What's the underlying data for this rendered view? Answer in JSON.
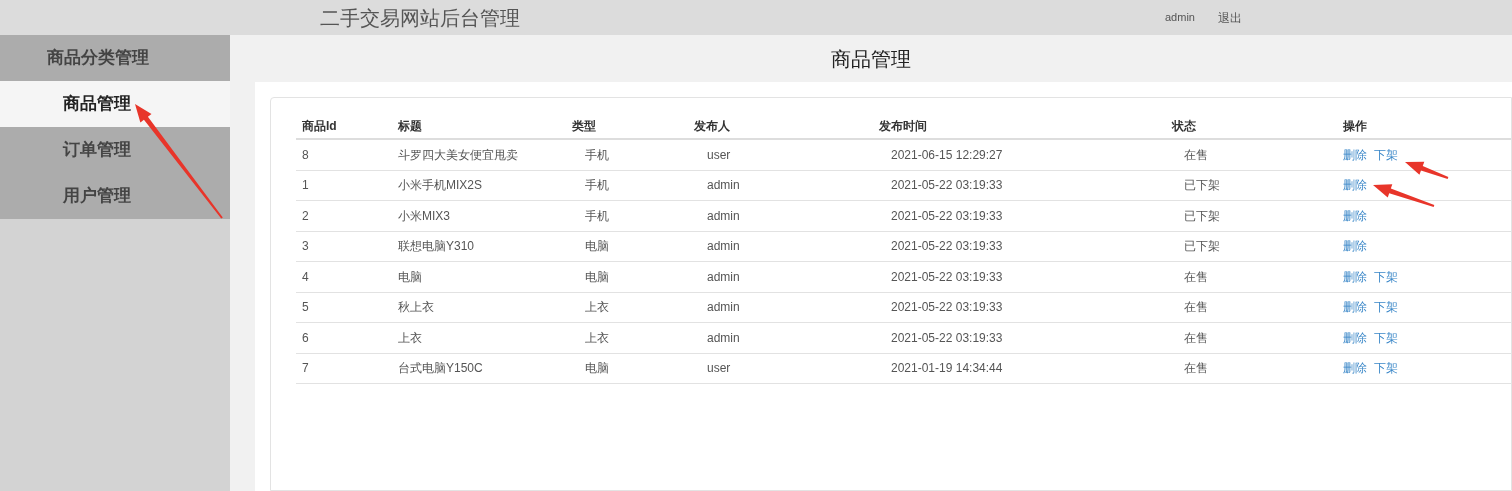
{
  "header": {
    "title": "二手交易网站后台管理",
    "user": "admin",
    "logout": "退出"
  },
  "sidebar": {
    "items": [
      {
        "label": "商品分类管理",
        "kind": "header",
        "selected": false
      },
      {
        "label": "商品管理",
        "kind": "item",
        "selected": true
      },
      {
        "label": "订单管理",
        "kind": "item",
        "selected": false
      },
      {
        "label": "用户管理",
        "kind": "item",
        "selected": false
      }
    ]
  },
  "page_title": "商品管理",
  "table": {
    "columns": [
      "商品Id",
      "标题",
      "类型",
      "发布人",
      "发布时间",
      "状态",
      "操作"
    ],
    "rows": [
      {
        "cells": [
          "8",
          "斗罗四大美女便宜甩卖",
          "手机",
          "user",
          "2021-06-15 12:29:27",
          "在售"
        ],
        "actions": [
          "删除",
          "下架"
        ]
      },
      {
        "cells": [
          "1",
          "小米手机MIX2S",
          "手机",
          "admin",
          "2021-05-22 03:19:33",
          "已下架"
        ],
        "actions": [
          "删除"
        ]
      },
      {
        "cells": [
          "2",
          "小米MIX3",
          "手机",
          "admin",
          "2021-05-22 03:19:33",
          "已下架"
        ],
        "actions": [
          "删除"
        ]
      },
      {
        "cells": [
          "3",
          "联想电脑Y310",
          "电脑",
          "admin",
          "2021-05-22 03:19:33",
          "已下架"
        ],
        "actions": [
          "删除"
        ]
      },
      {
        "cells": [
          "4",
          "电脑",
          "电脑",
          "admin",
          "2021-05-22 03:19:33",
          "在售"
        ],
        "actions": [
          "删除",
          "下架"
        ]
      },
      {
        "cells": [
          "5",
          "秋上衣",
          "上衣",
          "admin",
          "2021-05-22 03:19:33",
          "在售"
        ],
        "actions": [
          "删除",
          "下架"
        ]
      },
      {
        "cells": [
          "6",
          "上衣",
          "上衣",
          "admin",
          "2021-05-22 03:19:33",
          "在售"
        ],
        "actions": [
          "删除",
          "下架"
        ]
      },
      {
        "cells": [
          "7",
          "台式电脑Y150C",
          "电脑",
          "user",
          "2021-01-19 14:34:44",
          "在售"
        ],
        "actions": [
          "删除",
          "下架"
        ]
      }
    ]
  }
}
